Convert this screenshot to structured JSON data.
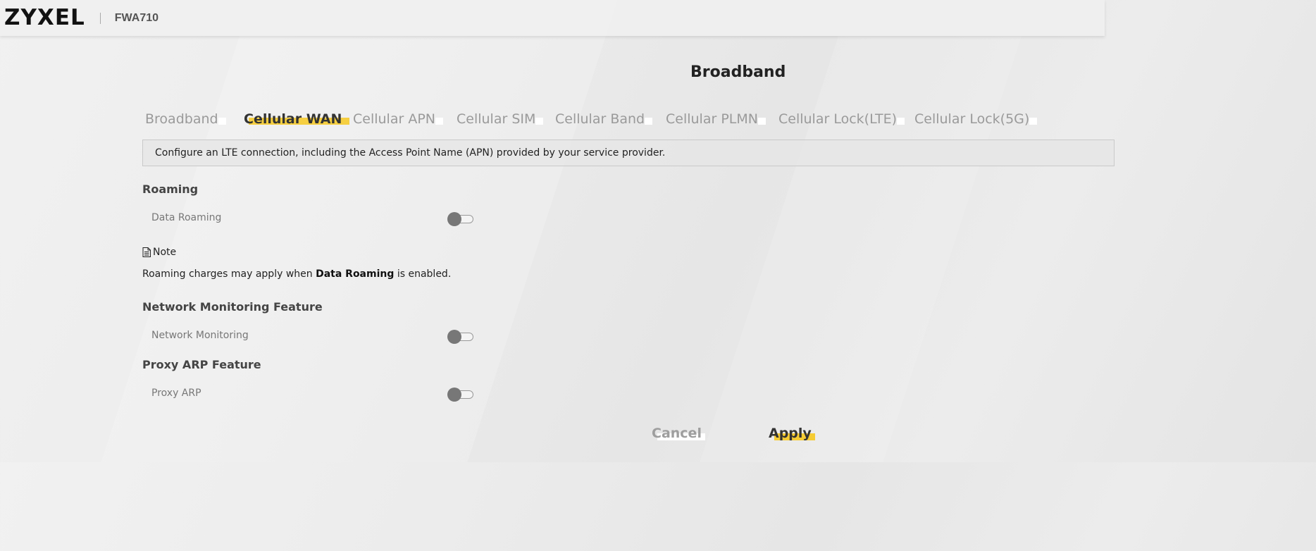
{
  "header": {
    "logo_text": "ZYXEL",
    "model": "FWA710"
  },
  "page_title": "Broadband",
  "tabs": [
    {
      "label": "Broadband",
      "active": false
    },
    {
      "label": "Cellular WAN",
      "active": true
    },
    {
      "label": "Cellular APN",
      "active": false
    },
    {
      "label": "Cellular SIM",
      "active": false
    },
    {
      "label": "Cellular Band",
      "active": false
    },
    {
      "label": "Cellular PLMN",
      "active": false
    },
    {
      "label": "Cellular Lock(LTE)",
      "active": false
    },
    {
      "label": "Cellular Lock(5G)",
      "active": false
    }
  ],
  "description": "Configure an LTE connection, including the Access Point Name (APN) provided by your service provider.",
  "roaming": {
    "title": "Roaming",
    "data_roaming_label": "Data Roaming",
    "data_roaming_enabled": false
  },
  "note": {
    "heading": "Note",
    "text_before": "Roaming charges may apply when ",
    "text_bold": "Data Roaming",
    "text_after": " is enabled."
  },
  "network_monitoring": {
    "title": "Network Monitoring Feature",
    "label": "Network Monitoring",
    "enabled": false
  },
  "proxy_arp": {
    "title": "Proxy ARP Feature",
    "label": "Proxy ARP",
    "enabled": false
  },
  "buttons": {
    "cancel": "Cancel",
    "apply": "Apply"
  },
  "colors": {
    "accent": "#f5c518",
    "toggle_off_knob": "#777777"
  }
}
